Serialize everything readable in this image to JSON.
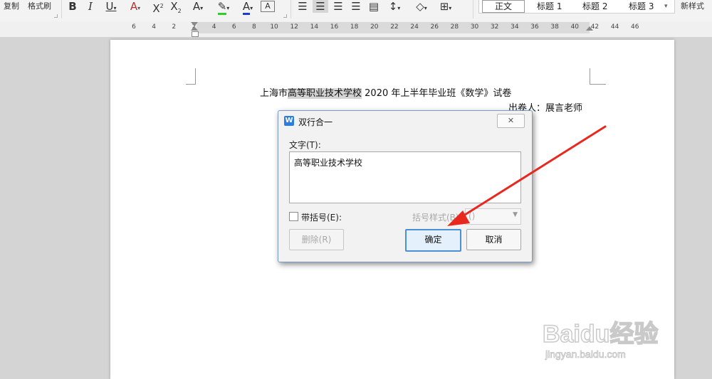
{
  "toolbar": {
    "copy": "复制",
    "format_painter": "格式刷",
    "styles": {
      "s0": "正文",
      "s1": "标题 1",
      "s2": "标题 2",
      "s3": "标题 3"
    },
    "new_style": "新样式"
  },
  "ruler": {
    "ticks": [
      "6",
      "4",
      "2",
      "2",
      "4",
      "6",
      "8",
      "10",
      "12",
      "14",
      "16",
      "18",
      "20",
      "22",
      "24",
      "26",
      "28",
      "30",
      "32",
      "34",
      "36",
      "38",
      "40",
      "42",
      "44",
      "46"
    ]
  },
  "document": {
    "title_before": "上海市",
    "title_highlight": "高等职业技术学校",
    "title_after": " 2020 年上半年毕业班《数学》试卷",
    "author": "出卷人：展言老师"
  },
  "dialog": {
    "title": "双行合一",
    "close_label": "",
    "text_label": "文字(T):",
    "text_value": "高等职业技术学校",
    "bracket_label": "带括号(E):",
    "bracket_style_label": "括号样式(B):",
    "bracket_style_value": "()",
    "delete_label": "删除(R)",
    "ok_label": "确定",
    "cancel_label": "取消"
  },
  "watermark": {
    "logo": "Baidu经验",
    "url": "jingyan.baidu.com"
  },
  "colors": {
    "arrow": "#e8281e",
    "accent": "#4a90d4"
  }
}
